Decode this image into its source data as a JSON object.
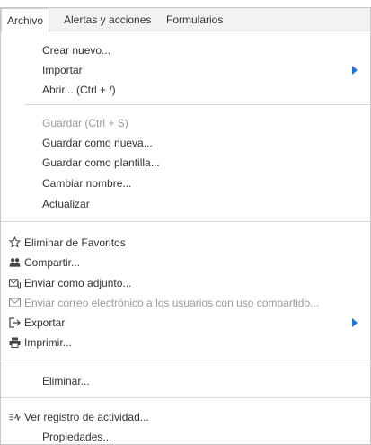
{
  "tabs": [
    {
      "label": "Archivo",
      "active": true
    },
    {
      "label": "Alertas y acciones",
      "active": false
    },
    {
      "label": "Formularios",
      "active": false
    }
  ],
  "items": {
    "crear_nuevo": "Crear nuevo...",
    "importar": "Importar",
    "abrir": "Abrir... (Ctrl + /)",
    "guardar": "Guardar (Ctrl + S)",
    "guardar_como_nueva": "Guardar como nueva...",
    "guardar_como_plantilla": "Guardar como plantilla...",
    "cambiar_nombre": "Cambiar nombre...",
    "actualizar": "Actualizar",
    "eliminar_favoritos": "Eliminar de Favoritos",
    "compartir": "Compartir...",
    "enviar_adjunto": "Enviar como adjunto...",
    "enviar_correo": "Enviar correo electrónico a los usuarios con uso compartido...",
    "exportar": "Exportar",
    "imprimir": "Imprimir...",
    "eliminar": "Eliminar...",
    "ver_registro": "Ver registro de actividad...",
    "propiedades": "Propiedades..."
  },
  "icons": {
    "favoritos": "star-outline-icon",
    "compartir": "people-icon",
    "adjunto": "attachment-mail-icon",
    "correo": "envelope-icon",
    "exportar": "export-icon",
    "imprimir": "printer-icon",
    "registro": "activity-log-icon"
  },
  "colors": {
    "submenu_arrow": "#1a73e8",
    "disabled_text": "#9a9a9a",
    "tabbar_bg": "#f2f2f2"
  }
}
